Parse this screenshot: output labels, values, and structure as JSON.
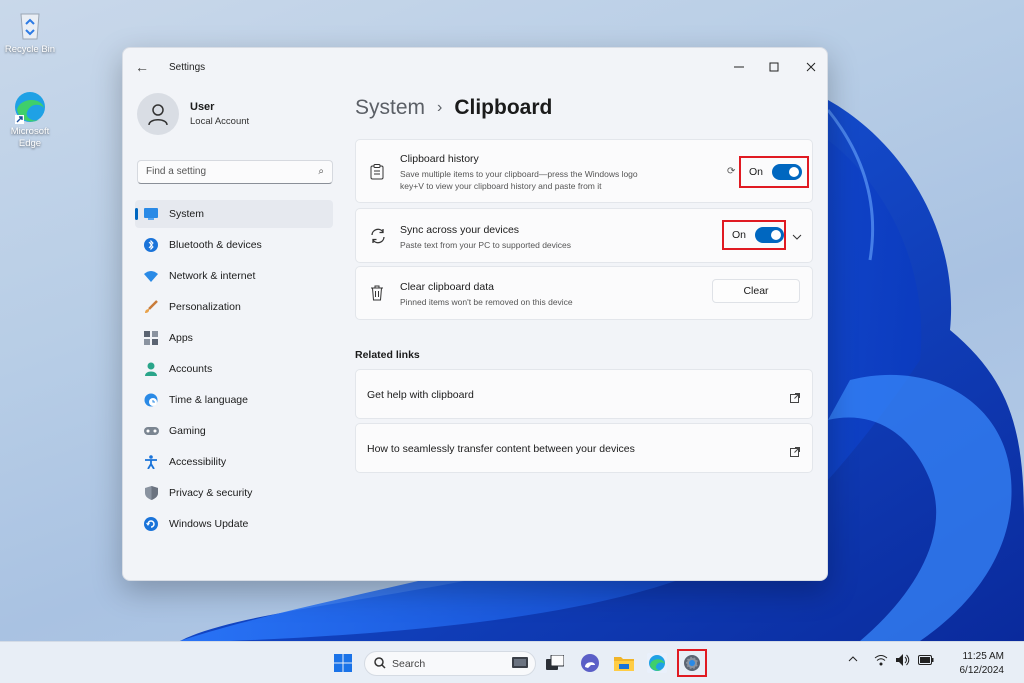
{
  "desktop": {
    "icons": [
      {
        "label": "Recycle Bin",
        "icon": "recycle-bin-icon"
      },
      {
        "label": "Microsoft Edge",
        "icon": "edge-icon"
      }
    ]
  },
  "window": {
    "title": "Settings",
    "controls": [
      "minimize",
      "maximize",
      "close"
    ]
  },
  "user": {
    "name": "User",
    "account": "Local Account"
  },
  "search": {
    "placeholder": "Find a setting"
  },
  "nav": {
    "items": [
      {
        "label": "System",
        "icon": "system-icon",
        "active": true
      },
      {
        "label": "Bluetooth & devices",
        "icon": "bluetooth-icon"
      },
      {
        "label": "Network & internet",
        "icon": "wifi-icon"
      },
      {
        "label": "Personalization",
        "icon": "brush-icon"
      },
      {
        "label": "Apps",
        "icon": "apps-icon"
      },
      {
        "label": "Accounts",
        "icon": "person-icon"
      },
      {
        "label": "Time & language",
        "icon": "globe-clock-icon"
      },
      {
        "label": "Gaming",
        "icon": "controller-icon"
      },
      {
        "label": "Accessibility",
        "icon": "accessibility-icon"
      },
      {
        "label": "Privacy & security",
        "icon": "shield-icon"
      },
      {
        "label": "Windows Update",
        "icon": "update-icon"
      }
    ]
  },
  "breadcrumb": {
    "parent": "System",
    "separator": "›",
    "current": "Clipboard"
  },
  "settings": {
    "clipboard_history": {
      "title": "Clipboard history",
      "description_line1": "Save multiple items to your clipboard—press the Windows logo",
      "description_line2": "key+V to view your clipboard history and paste from it",
      "state": "On"
    },
    "sync": {
      "title": "Sync across your devices",
      "description": "Paste text from your PC to supported devices",
      "state": "On"
    },
    "clear": {
      "title": "Clear clipboard data",
      "description": "Pinned items won't be removed on this device",
      "button": "Clear"
    }
  },
  "related": {
    "heading": "Related links",
    "links": [
      {
        "label": "Get help with clipboard"
      },
      {
        "label": "How to seamlessly transfer content between your devices"
      }
    ]
  },
  "taskbar": {
    "search_label": "Search",
    "apps": [
      "windows-start-icon",
      "widget-icon",
      "task-view-icon",
      "chat-icon",
      "file-explorer-icon",
      "edge-icon",
      "settings-icon"
    ],
    "time": "11:25 AM",
    "date": "6/12/2024"
  },
  "colors": {
    "accent": "#0067c0",
    "highlight": "#e01a22"
  }
}
